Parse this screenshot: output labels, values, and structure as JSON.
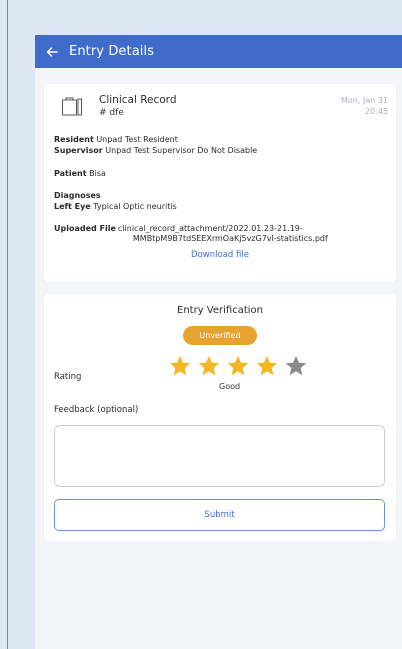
{
  "header": {
    "back_icon": "arrow-left-icon",
    "title": "Entry Details"
  },
  "record": {
    "icon": "clipboard-icon",
    "title": "Clinical Record",
    "subtitle": "# dfe",
    "date": "Mon, Jan 31",
    "time": "20:45",
    "resident_label": "Resident",
    "resident_value": "Unpad Test Resident",
    "supervisor_label": "Supervisor",
    "supervisor_value": "Unpad Test Supervisor Do Not Disable",
    "patient_label": "Patient",
    "patient_value": "Bisa",
    "diagnoses_label": "Diagnoses",
    "eye_label": "Left Eye",
    "eye_value": "Typical Optic neuritis",
    "uploaded_label": "Uploaded File",
    "uploaded_line1": "clinical_record_attachment/2022.01.23-21.19-",
    "uploaded_line2": "MMBtpM9B7tdSEEXrmOaKj5vzG7vl-statistics.pdf",
    "download_label": "Download file"
  },
  "verification": {
    "title": "Entry Verification",
    "status": "Unverified",
    "status_color": "#e8a230",
    "rating_label": "Rating",
    "rating_value": 4,
    "rating_max": 5,
    "rating_text": "Good",
    "star_filled_color": "#f2b824",
    "star_empty_color": "#8a8a8a",
    "feedback_label": "Feedback (optional)",
    "feedback_value": "",
    "submit_label": "Submit"
  },
  "theme": {
    "primary": "#3f6ccb"
  }
}
